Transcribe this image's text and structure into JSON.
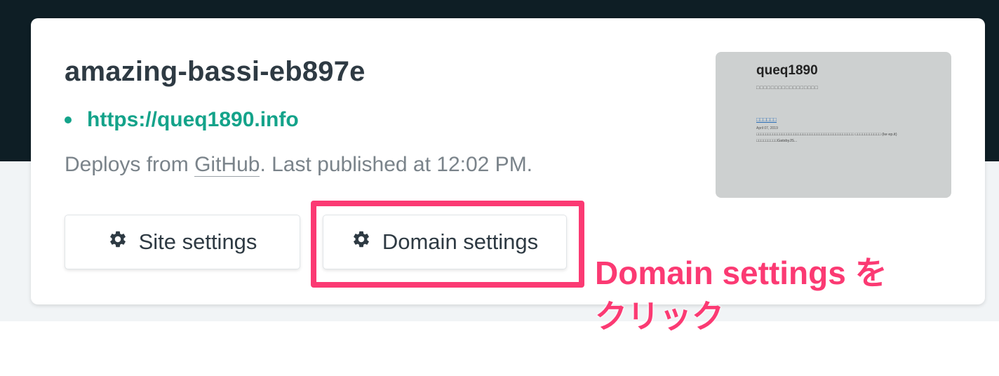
{
  "site": {
    "name": "amazing-bassi-eb897e",
    "url": "https://queq1890.info",
    "deploy_prefix": "Deploys from ",
    "deploy_source": "GitHub",
    "deploy_suffix": ". Last published at 12:02 PM."
  },
  "buttons": {
    "site_settings": "Site settings",
    "domain_settings": "Domain settings"
  },
  "preview": {
    "title": "queq1890",
    "subtitle": "□□□□□□□□□□□□□□□□□",
    "post_link": "□□□□□□",
    "post_date": "April 07, 2019",
    "post_excerpt": "□□□□□□□□□□□□□□□□□□□□□□□□□□□□□□□□□□□□□□□□□□ □□□□□□□□□□□ (ke ep.it) □□□□□□□□□GatsbyJS..."
  },
  "annotation": {
    "line1": "Domain settings を",
    "line2": "クリック"
  },
  "colors": {
    "header_bg": "#0e1e25",
    "accent_teal": "#14a38a",
    "highlight_pink": "#fb3a73"
  },
  "icons": {
    "settings": "gear-icon"
  }
}
